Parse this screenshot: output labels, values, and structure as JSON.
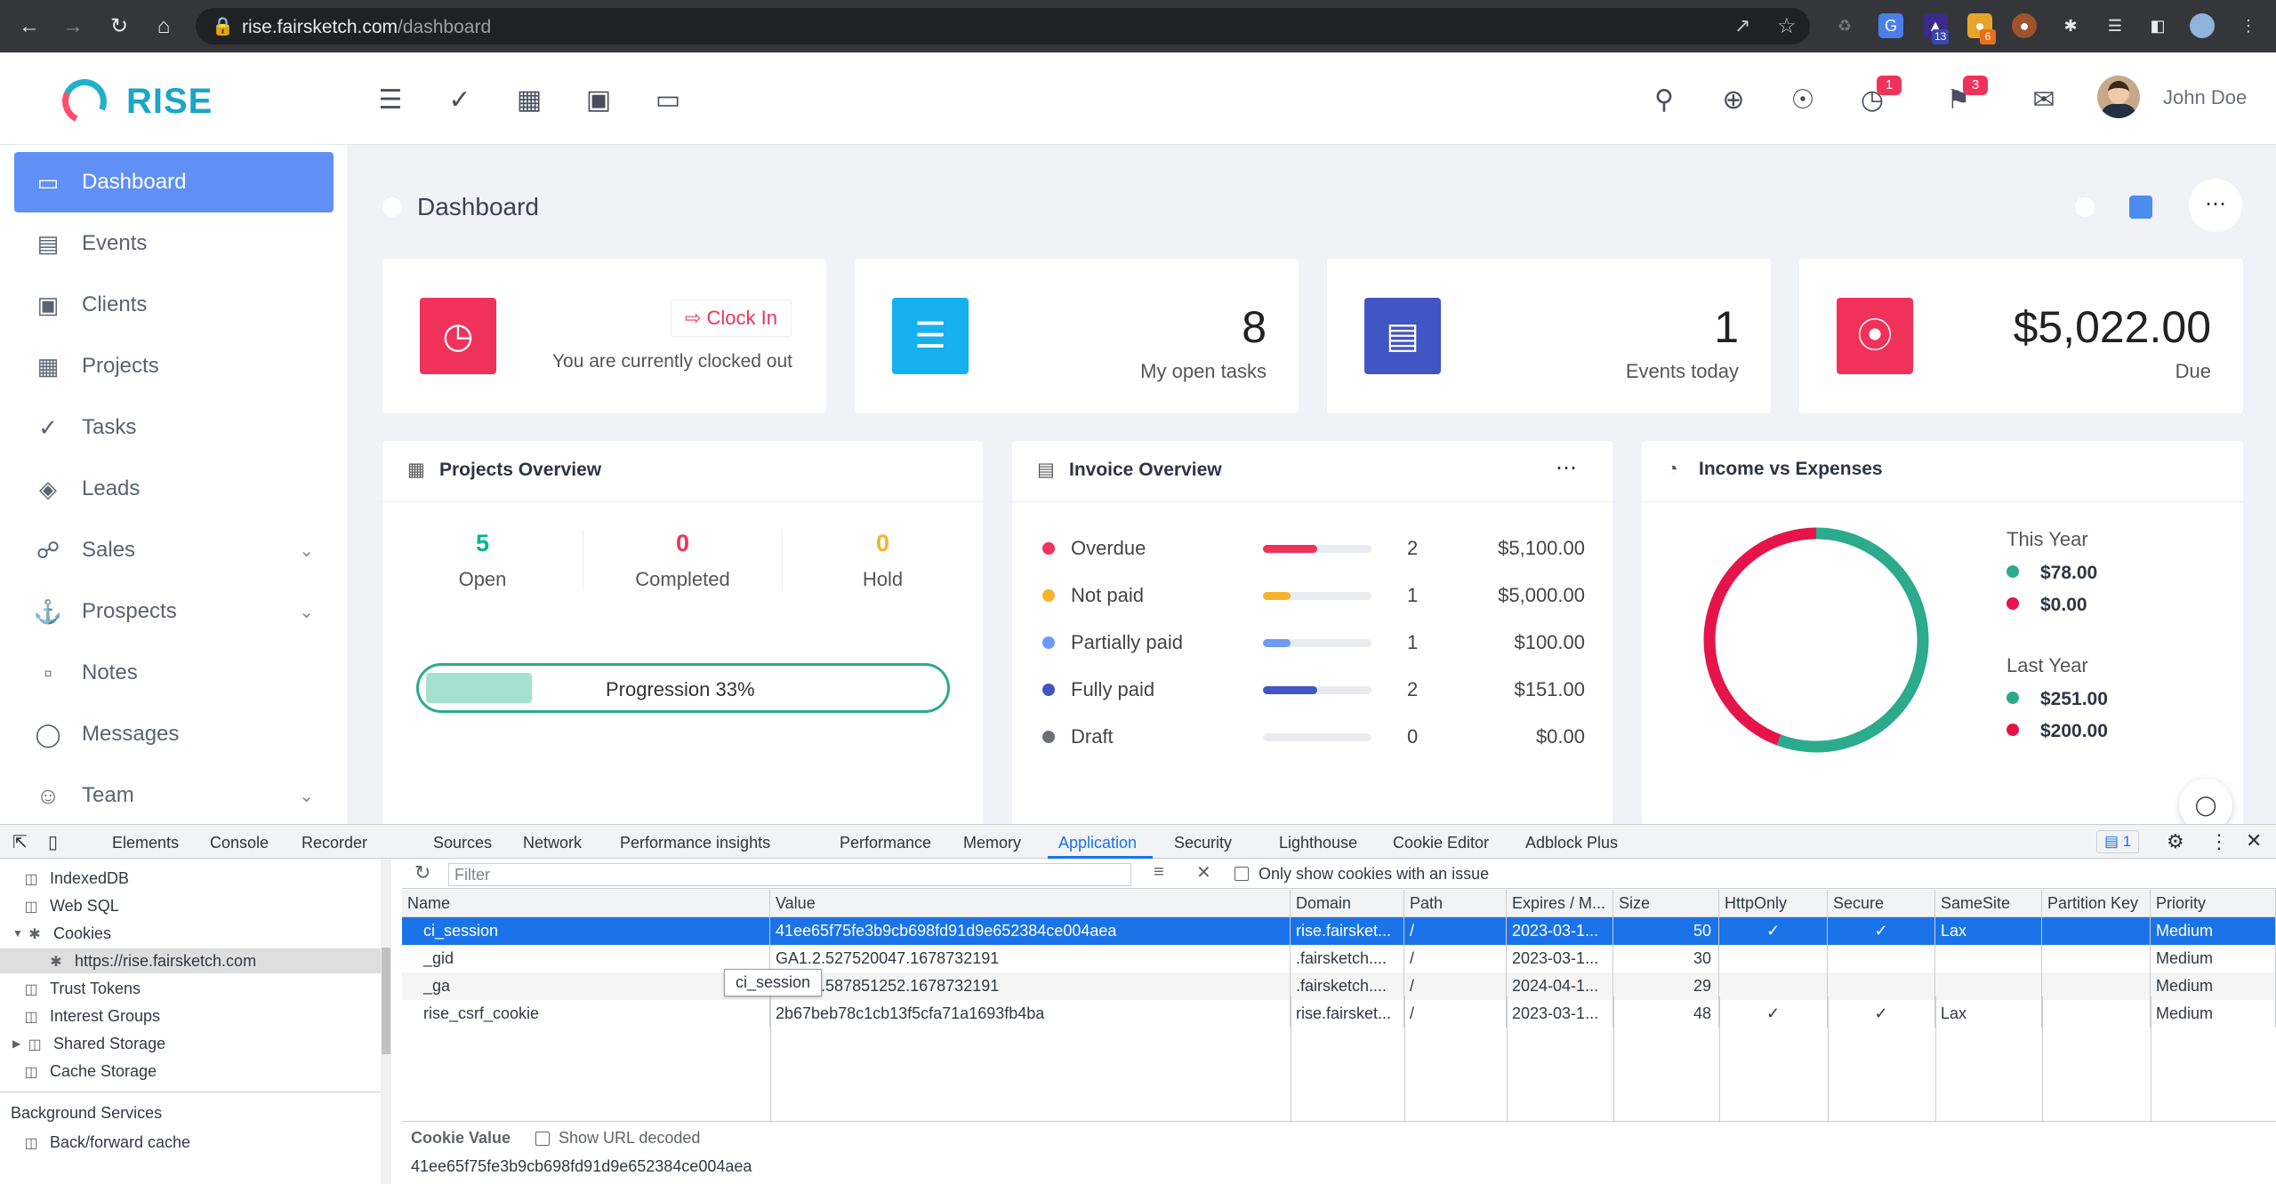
{
  "browser": {
    "url_host": "rise.fairsketch.com",
    "url_path": "/dashboard",
    "ext_badges": [
      "13",
      "6"
    ]
  },
  "app": {
    "brand": "RISE",
    "user_name": "John Doe",
    "badges": {
      "reminders": "1",
      "notifications": "3"
    },
    "page_title": "Dashboard",
    "sidebar": [
      {
        "label": "Dashboard",
        "icon": "monitor-icon"
      },
      {
        "label": "Events",
        "icon": "calendar-icon"
      },
      {
        "label": "Clients",
        "icon": "briefcase-icon"
      },
      {
        "label": "Projects",
        "icon": "grid-icon"
      },
      {
        "label": "Tasks",
        "icon": "check-circle-icon"
      },
      {
        "label": "Leads",
        "icon": "layers-icon"
      },
      {
        "label": "Sales",
        "icon": "cart-icon"
      },
      {
        "label": "Prospects",
        "icon": "anchor-icon"
      },
      {
        "label": "Notes",
        "icon": "book-icon"
      },
      {
        "label": "Messages",
        "icon": "message-icon"
      },
      {
        "label": "Team",
        "icon": "users-icon"
      }
    ],
    "cards": {
      "clock_in": {
        "button": "Clock In",
        "status": "You are currently clocked out"
      },
      "tasks": {
        "value": "8",
        "label": "My open tasks"
      },
      "events": {
        "value": "1",
        "label": "Events today"
      },
      "due": {
        "value": "$5,022.00",
        "label": "Due"
      }
    },
    "projects_overview": {
      "title": "Projects Overview",
      "stats": [
        {
          "value": "5",
          "label": "Open",
          "color": "#00b393"
        },
        {
          "value": "0",
          "label": "Completed",
          "color": "#f0325b"
        },
        {
          "value": "0",
          "label": "Hold",
          "color": "#f5b32b"
        }
      ],
      "progress_label": "Progression 33%",
      "progress": 0.33
    },
    "invoice_overview": {
      "title": "Invoice Overview",
      "rows": [
        {
          "name": "Overdue",
          "count": "2",
          "amount": "$5,100.00",
          "color": "#f0325b",
          "fill": 0.5
        },
        {
          "name": "Not paid",
          "count": "1",
          "amount": "$5,000.00",
          "color": "#f5b32b",
          "fill": 0.25
        },
        {
          "name": "Partially paid",
          "count": "1",
          "amount": "$100.00",
          "color": "#6c9bf5",
          "fill": 0.25
        },
        {
          "name": "Fully paid",
          "count": "2",
          "amount": "$151.00",
          "color": "#4255c4",
          "fill": 0.5
        },
        {
          "name": "Draft",
          "count": "0",
          "amount": "$0.00",
          "color": "#6c6f78",
          "fill": 0
        }
      ]
    },
    "income_expenses": {
      "title": "Income vs Expenses",
      "this_year_label": "This Year",
      "this_year": [
        "$78.00",
        "$0.00"
      ],
      "last_year_label": "Last Year",
      "last_year": [
        "$251.00",
        "$200.00"
      ],
      "income_color": "#2bab8b",
      "expense_color": "#e5154a",
      "chart_data": {
        "type": "pie",
        "categories": [
          "Income",
          "Expenses"
        ],
        "values": [
          251,
          200
        ]
      }
    }
  },
  "devtools": {
    "tabs": [
      "Elements",
      "Console",
      "Recorder",
      "Sources",
      "Network",
      "Performance insights",
      "Performance",
      "Memory",
      "Application",
      "Security",
      "Lighthouse",
      "Cookie Editor",
      "Adblock Plus"
    ],
    "issue_count": "1",
    "tree": [
      "IndexedDB",
      "Web SQL",
      "Cookies",
      "https://rise.fairsketch.com",
      "Trust Tokens",
      "Interest Groups",
      "Shared Storage",
      "Cache Storage"
    ],
    "background_services": "Background Services",
    "bfcache": "Back/forward cache",
    "filter_placeholder": "Filter",
    "only_issues_label": "Only show cookies with an issue",
    "columns": [
      "Name",
      "Value",
      "Domain",
      "Path",
      "Expires / M...",
      "Size",
      "HttpOnly",
      "Secure",
      "SameSite",
      "Partition Key",
      "Priority"
    ],
    "cookies": [
      [
        "ci_session",
        "41ee65f75fe3b9cb698fd91d9e652384ce004aea",
        "rise.fairsket...",
        "/",
        "2023-03-1...",
        "50",
        "✓",
        "✓",
        "Lax",
        "",
        "Medium"
      ],
      [
        "_gid",
        "GA1.2.527520047.1678732191",
        ".fairsketch....",
        "/",
        "2023-03-1...",
        "30",
        "",
        "",
        "",
        "",
        "Medium"
      ],
      [
        "_ga",
        "GA1.2.587851252.1678732191",
        ".fairsketch....",
        "/",
        "2024-04-1...",
        "29",
        "",
        "",
        "",
        "",
        "Medium"
      ],
      [
        "rise_csrf_cookie",
        "2b67beb78c1cb13f5cfa71a1693fb4ba",
        "rise.fairsket...",
        "/",
        "2023-03-1...",
        "48",
        "✓",
        "✓",
        "Lax",
        "",
        "Medium"
      ]
    ],
    "tooltip": "ci_session",
    "cookie_value_label": "Cookie Value",
    "show_url_decoded": "Show URL decoded",
    "cookie_value": "41ee65f75fe3b9cb698fd91d9e652384ce004aea"
  }
}
